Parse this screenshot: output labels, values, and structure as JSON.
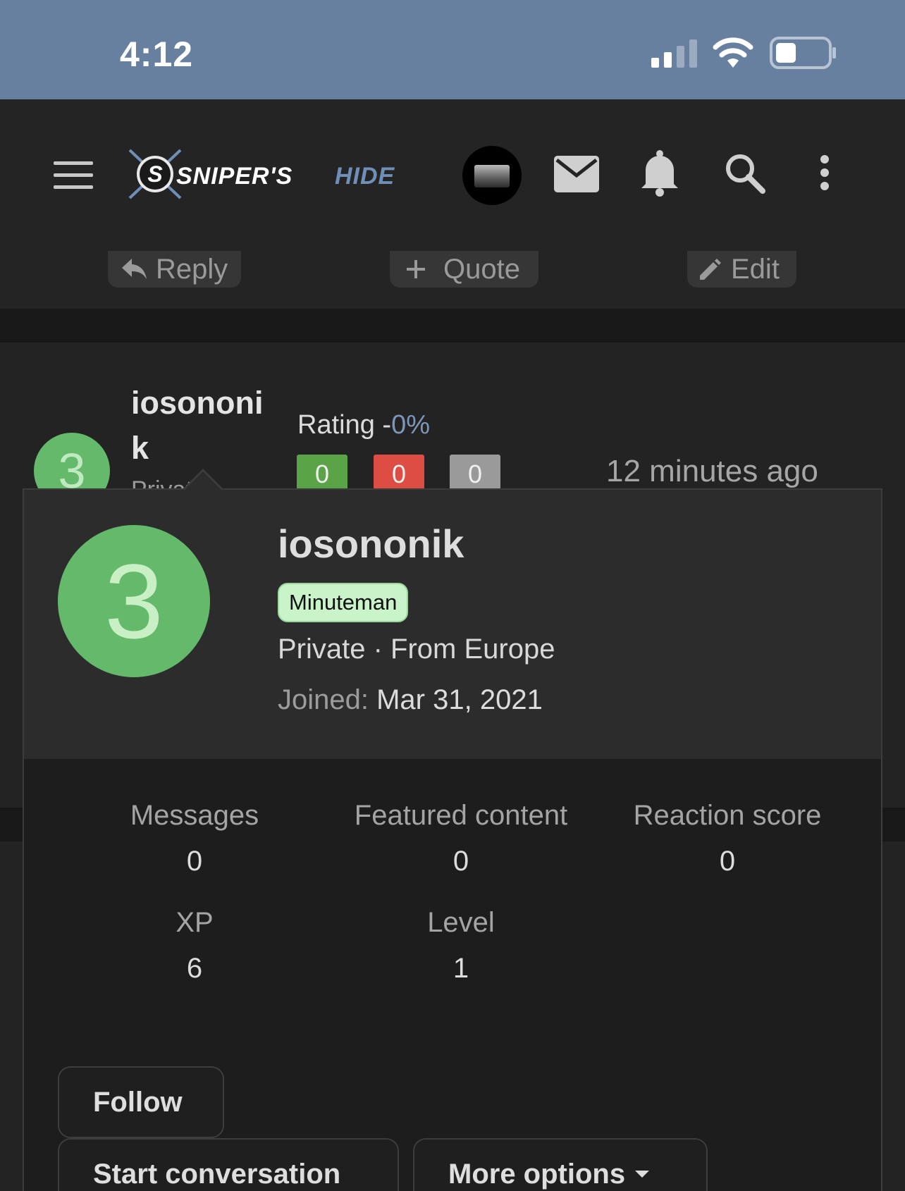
{
  "status_bar": {
    "time": "4:12"
  },
  "header": {
    "logo_text": "SNIPER'S HIDE",
    "icons": [
      "menu-icon",
      "avatar",
      "mail-icon",
      "bell-icon",
      "search-icon",
      "kebab-icon"
    ]
  },
  "post_actions": {
    "reply": "Reply",
    "quote": "Quote",
    "edit": "Edit"
  },
  "post": {
    "avatar_letter": "3",
    "username": "iosononik",
    "user_title_peek": "Private",
    "rating_label": "Rating -",
    "rating_pct": "0%",
    "rating_counts": [
      "0",
      "0",
      "0"
    ],
    "time": "12 minutes ago"
  },
  "popup": {
    "avatar_letter": "3",
    "username": "iosononik",
    "badge": "Minuteman",
    "title_line": "Private · From Europe",
    "joined_label": "Joined:",
    "joined_value": "Mar 31, 2021",
    "stats": [
      {
        "label": "Messages",
        "value": "0"
      },
      {
        "label": "Featured content",
        "value": "0"
      },
      {
        "label": "Reaction score",
        "value": "0"
      },
      {
        "label": "XP",
        "value": "6"
      },
      {
        "label": "Level",
        "value": "1"
      }
    ],
    "buttons": {
      "follow": "Follow",
      "conversation": "Start conversation",
      "more": "More options"
    }
  },
  "colors": {
    "status_bar": "#68809f",
    "avatar_green": "#64b96a",
    "badge_bg": "#c9f3c9",
    "rating_green": "#5aa447",
    "rating_red": "#de4d43",
    "rating_grey": "#9a9a9a"
  }
}
